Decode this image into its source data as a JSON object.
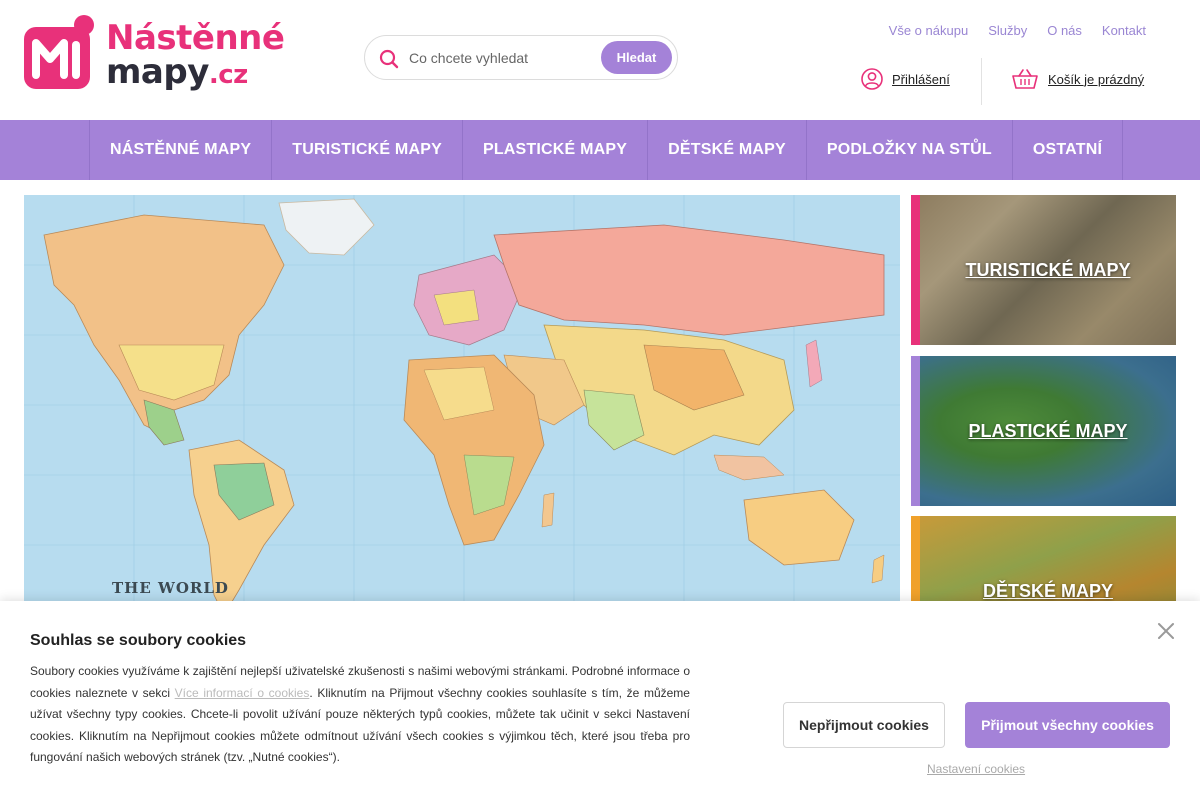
{
  "header": {
    "logo": {
      "line1": "Nástěnné",
      "line2": "mapy",
      "tld": ".cz"
    },
    "search": {
      "placeholder": "Co chcete vyhledat",
      "button_label": "Hledat"
    },
    "top_links": [
      "Vše o nákupu",
      "Služby",
      "O nás",
      "Kontakt"
    ],
    "login_label": "Přihlášení",
    "cart_label": "Košík je prázdný"
  },
  "nav": {
    "items": [
      "NÁSTĚNNÉ MAPY",
      "TURISTICKÉ MAPY",
      "PLASTICKÉ MAPY",
      "DĚTSKÉ MAPY",
      "PODLOŽKY NA STŮL",
      "OSTATNÍ"
    ]
  },
  "hero": {
    "caption": "THE WORLD"
  },
  "tiles": [
    {
      "label": "TURISTICKÉ MAPY",
      "accent": "#e8317a"
    },
    {
      "label": "PLASTICKÉ MAPY",
      "accent": "#a482d8"
    },
    {
      "label": "DĚTSKÉ MAPY",
      "accent": "#f0a12b"
    }
  ],
  "cookie": {
    "title": "Souhlas se soubory cookies",
    "text_before_link": "Soubory cookies využíváme k zajištění nejlepší uživatelské zkušenosti s našimi webovými stránkami. Podrobné informace o cookies naleznete v sekci ",
    "link_label": "Více informací o cookies",
    "text_after_link": ". Kliknutím na Přijmout všechny cookies souhlasíte s tím, že můžeme užívat všechny typy cookies. Chcete-li povolit užívání pouze některých typů cookies, můžete tak učinit v sekci Nastavení cookies. Kliknutím na Nepřijmout cookies můžete odmítnout užívání všech cookies s výjimkou těch, které jsou třeba pro fungování našich webových stránek (tzv. „Nutné cookies“).",
    "reject_label": "Nepřijmout cookies",
    "accept_label": "Přijmout všechny cookies",
    "settings_label": "Nastavení cookies"
  },
  "colors": {
    "brand_pink": "#e8317a",
    "brand_purple": "#a482d8",
    "link_purple": "#9a86d3",
    "dark": "#2d2d3a"
  },
  "icons": {
    "search": "search-icon",
    "user": "user-icon",
    "cart": "basket-icon",
    "close": "close-icon"
  }
}
